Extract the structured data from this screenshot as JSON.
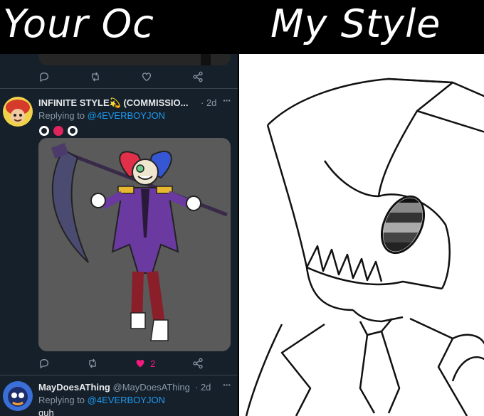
{
  "header": {
    "left_title": "Your Oc",
    "right_title": "My Style"
  },
  "tweet1": {
    "author": "INFINITE STYLE💫 (COMMISSIO...",
    "time": "· 2d",
    "more": "···",
    "replying_prefix": "Replying to ",
    "replying_handle": "@4EVERBOYJON",
    "likes": "2"
  },
  "tweet2": {
    "author": "MayDoesAThing",
    "handle": "@MayDoesAThing",
    "time": "· 2d",
    "more": "···",
    "replying_prefix": "Replying to ",
    "replying_handle": "@4EVERBOYJON",
    "text": "guh"
  },
  "colors": {
    "bg": "#15202b",
    "link": "#1d9bf0",
    "muted": "#8b98a5",
    "like": "#f91880"
  }
}
